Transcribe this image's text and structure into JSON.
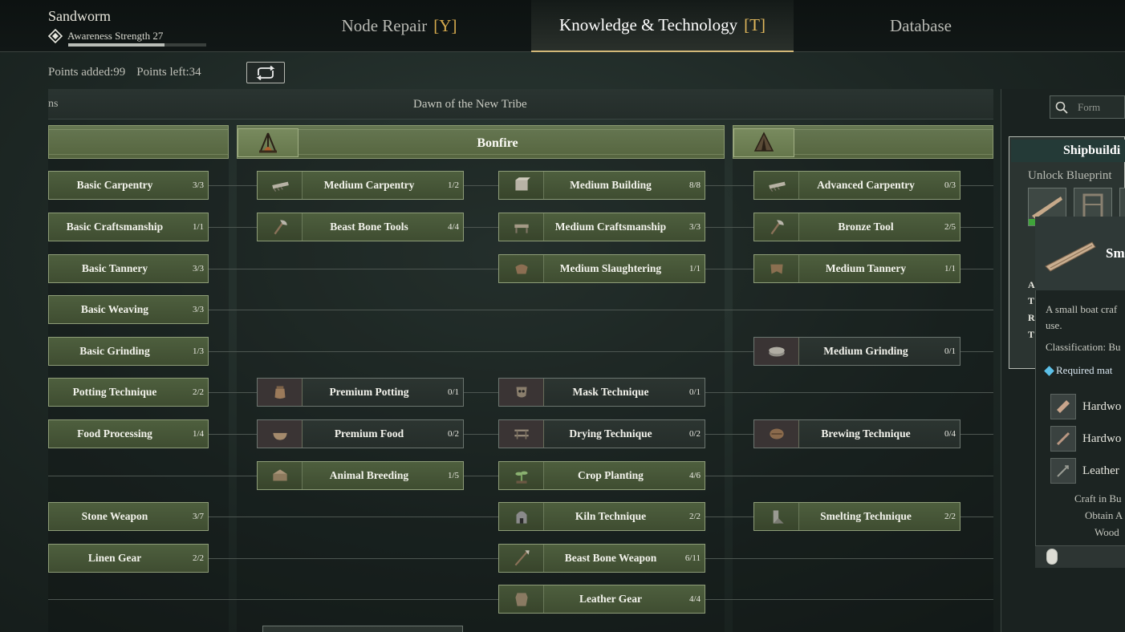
{
  "header": {
    "player_name": "Sandworm",
    "awareness_label": "Awareness Strength 27",
    "awareness_progress": 0.7,
    "tabs": [
      {
        "label": "Node Repair",
        "key": "[Y]"
      },
      {
        "label": "Knowledge & Technology",
        "key": "[T]"
      },
      {
        "label": "Database",
        "key": ""
      }
    ]
  },
  "points": {
    "added": "Points added:99",
    "left": "Points left:34"
  },
  "tree": {
    "prev_title": "ns",
    "title": "Dawn of the New Tribe",
    "center_column": "Bonfire",
    "left_nodes": [
      {
        "name": "Basic Carpentry",
        "count": "3/3"
      },
      {
        "name": "Basic Craftsmanship",
        "count": "1/1"
      },
      {
        "name": "Basic Tannery",
        "count": "3/3"
      },
      {
        "name": "Basic Weaving",
        "count": "3/3"
      },
      {
        "name": "Basic Grinding",
        "count": "1/3"
      },
      {
        "name": "Potting Technique",
        "count": "2/2"
      },
      {
        "name": "Food Processing",
        "count": "1/4"
      },
      {
        "name": "Stone Weapon",
        "count": "3/7"
      },
      {
        "name": "Linen Gear",
        "count": "2/2"
      }
    ],
    "col2_nodes": [
      {
        "name": "Medium Carpentry",
        "count": "1/2"
      },
      {
        "name": "Beast Bone Tools",
        "count": "4/4"
      },
      {
        "name": "Premium Potting",
        "count": "0/1"
      },
      {
        "name": "Premium Food",
        "count": "0/2"
      },
      {
        "name": "Animal Breeding",
        "count": "1/5"
      }
    ],
    "col3_nodes": [
      {
        "name": "Medium Building",
        "count": "8/8"
      },
      {
        "name": "Medium Craftsmanship",
        "count": "3/3"
      },
      {
        "name": "Medium Slaughtering",
        "count": "1/1"
      },
      {
        "name": "Mask Technique",
        "count": "0/1"
      },
      {
        "name": "Drying Technique",
        "count": "0/2"
      },
      {
        "name": "Crop Planting",
        "count": "4/6"
      },
      {
        "name": "Kiln Technique",
        "count": "2/2"
      },
      {
        "name": "Beast Bone Weapon",
        "count": "6/11"
      },
      {
        "name": "Leather Gear",
        "count": "4/4"
      }
    ],
    "col4_nodes": [
      {
        "name": "Advanced Carpentry",
        "count": "0/3"
      },
      {
        "name": "Bronze Tool",
        "count": "2/5"
      },
      {
        "name": "Medium Tannery",
        "count": "1/1"
      },
      {
        "name": "Medium Grinding",
        "count": "0/1"
      },
      {
        "name": "Brewing Technique",
        "count": "0/4"
      },
      {
        "name": "Smelting Technique",
        "count": "2/2"
      }
    ]
  },
  "right_panel": {
    "search_placeholder": "Form",
    "card_title": "Shipbuildi",
    "card_subtitle": "Unlock Blueprint",
    "letters": [
      "A",
      "T",
      "R",
      "T"
    ],
    "tooltip": {
      "name": "Sm",
      "desc_line1": "A small boat craf",
      "desc_line2": "use.",
      "classification": "Classification: Bu",
      "required": "Required mat",
      "materials": [
        "Hardwo",
        "Hardwo",
        "Leather"
      ],
      "lines": [
        "Craft in Bu",
        "Obtain A",
        "Wood"
      ]
    }
  },
  "colors": {
    "node_unlocked": "#4e5f3e",
    "node_locked": "#2c3531",
    "tab_key": "#d4a94d",
    "accent_blue": "#5cc0e8"
  }
}
